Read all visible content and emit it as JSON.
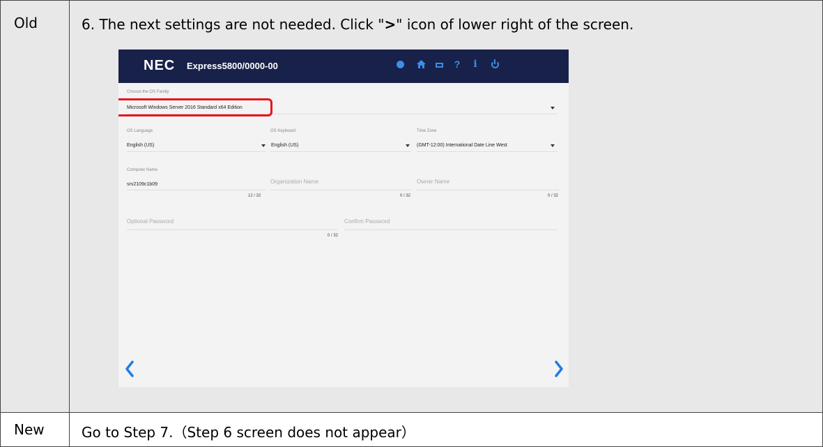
{
  "old": {
    "label": "Old",
    "instruction_pre": "6. The next settings are not needed. Click \"",
    "instruction_symbol": ">",
    "instruction_post": "\" icon of lower right of the screen."
  },
  "new": {
    "label": "New",
    "text": "Go to Step 7.（Step 6 screen does not appear）"
  },
  "screenshot": {
    "logo": "NEC",
    "model": "Express5800/0000-00",
    "header_icons": [
      "globe-icon",
      "home-icon",
      "cart-icon",
      "help-icon",
      "info-icon",
      "power-icon"
    ],
    "help_glyph": "?",
    "info_glyph": "i",
    "os_family_label": "Choose the OS Family",
    "os_family_value": "Microsoft Windows Server 2016 Standard x64 Edition",
    "os_language_label": "OS Language",
    "os_language_value": "English (US)",
    "os_keyboard_label": "OS Keyboard",
    "os_keyboard_value": "English (US)",
    "time_zone_label": "Time Zone",
    "time_zone_value": "(GMT-12:00) International Date Line West",
    "computer_name_label": "Computer Name",
    "computer_name_value": "srv2109c1b09",
    "computer_name_counter": "12 / 32",
    "organization_placeholder": "Organization Name",
    "organization_counter": "0 / 32",
    "owner_placeholder": "Owner Name",
    "owner_counter": "0 / 32",
    "password_placeholder": "Optional Password",
    "confirm_placeholder": "Confirm Password",
    "password_counter": "0 / 32"
  },
  "colors": {
    "header_bg": "#18214a",
    "accent": "#3b8fe6",
    "highlight": "#e8141b",
    "old_row_bg": "#e8e8e8"
  }
}
